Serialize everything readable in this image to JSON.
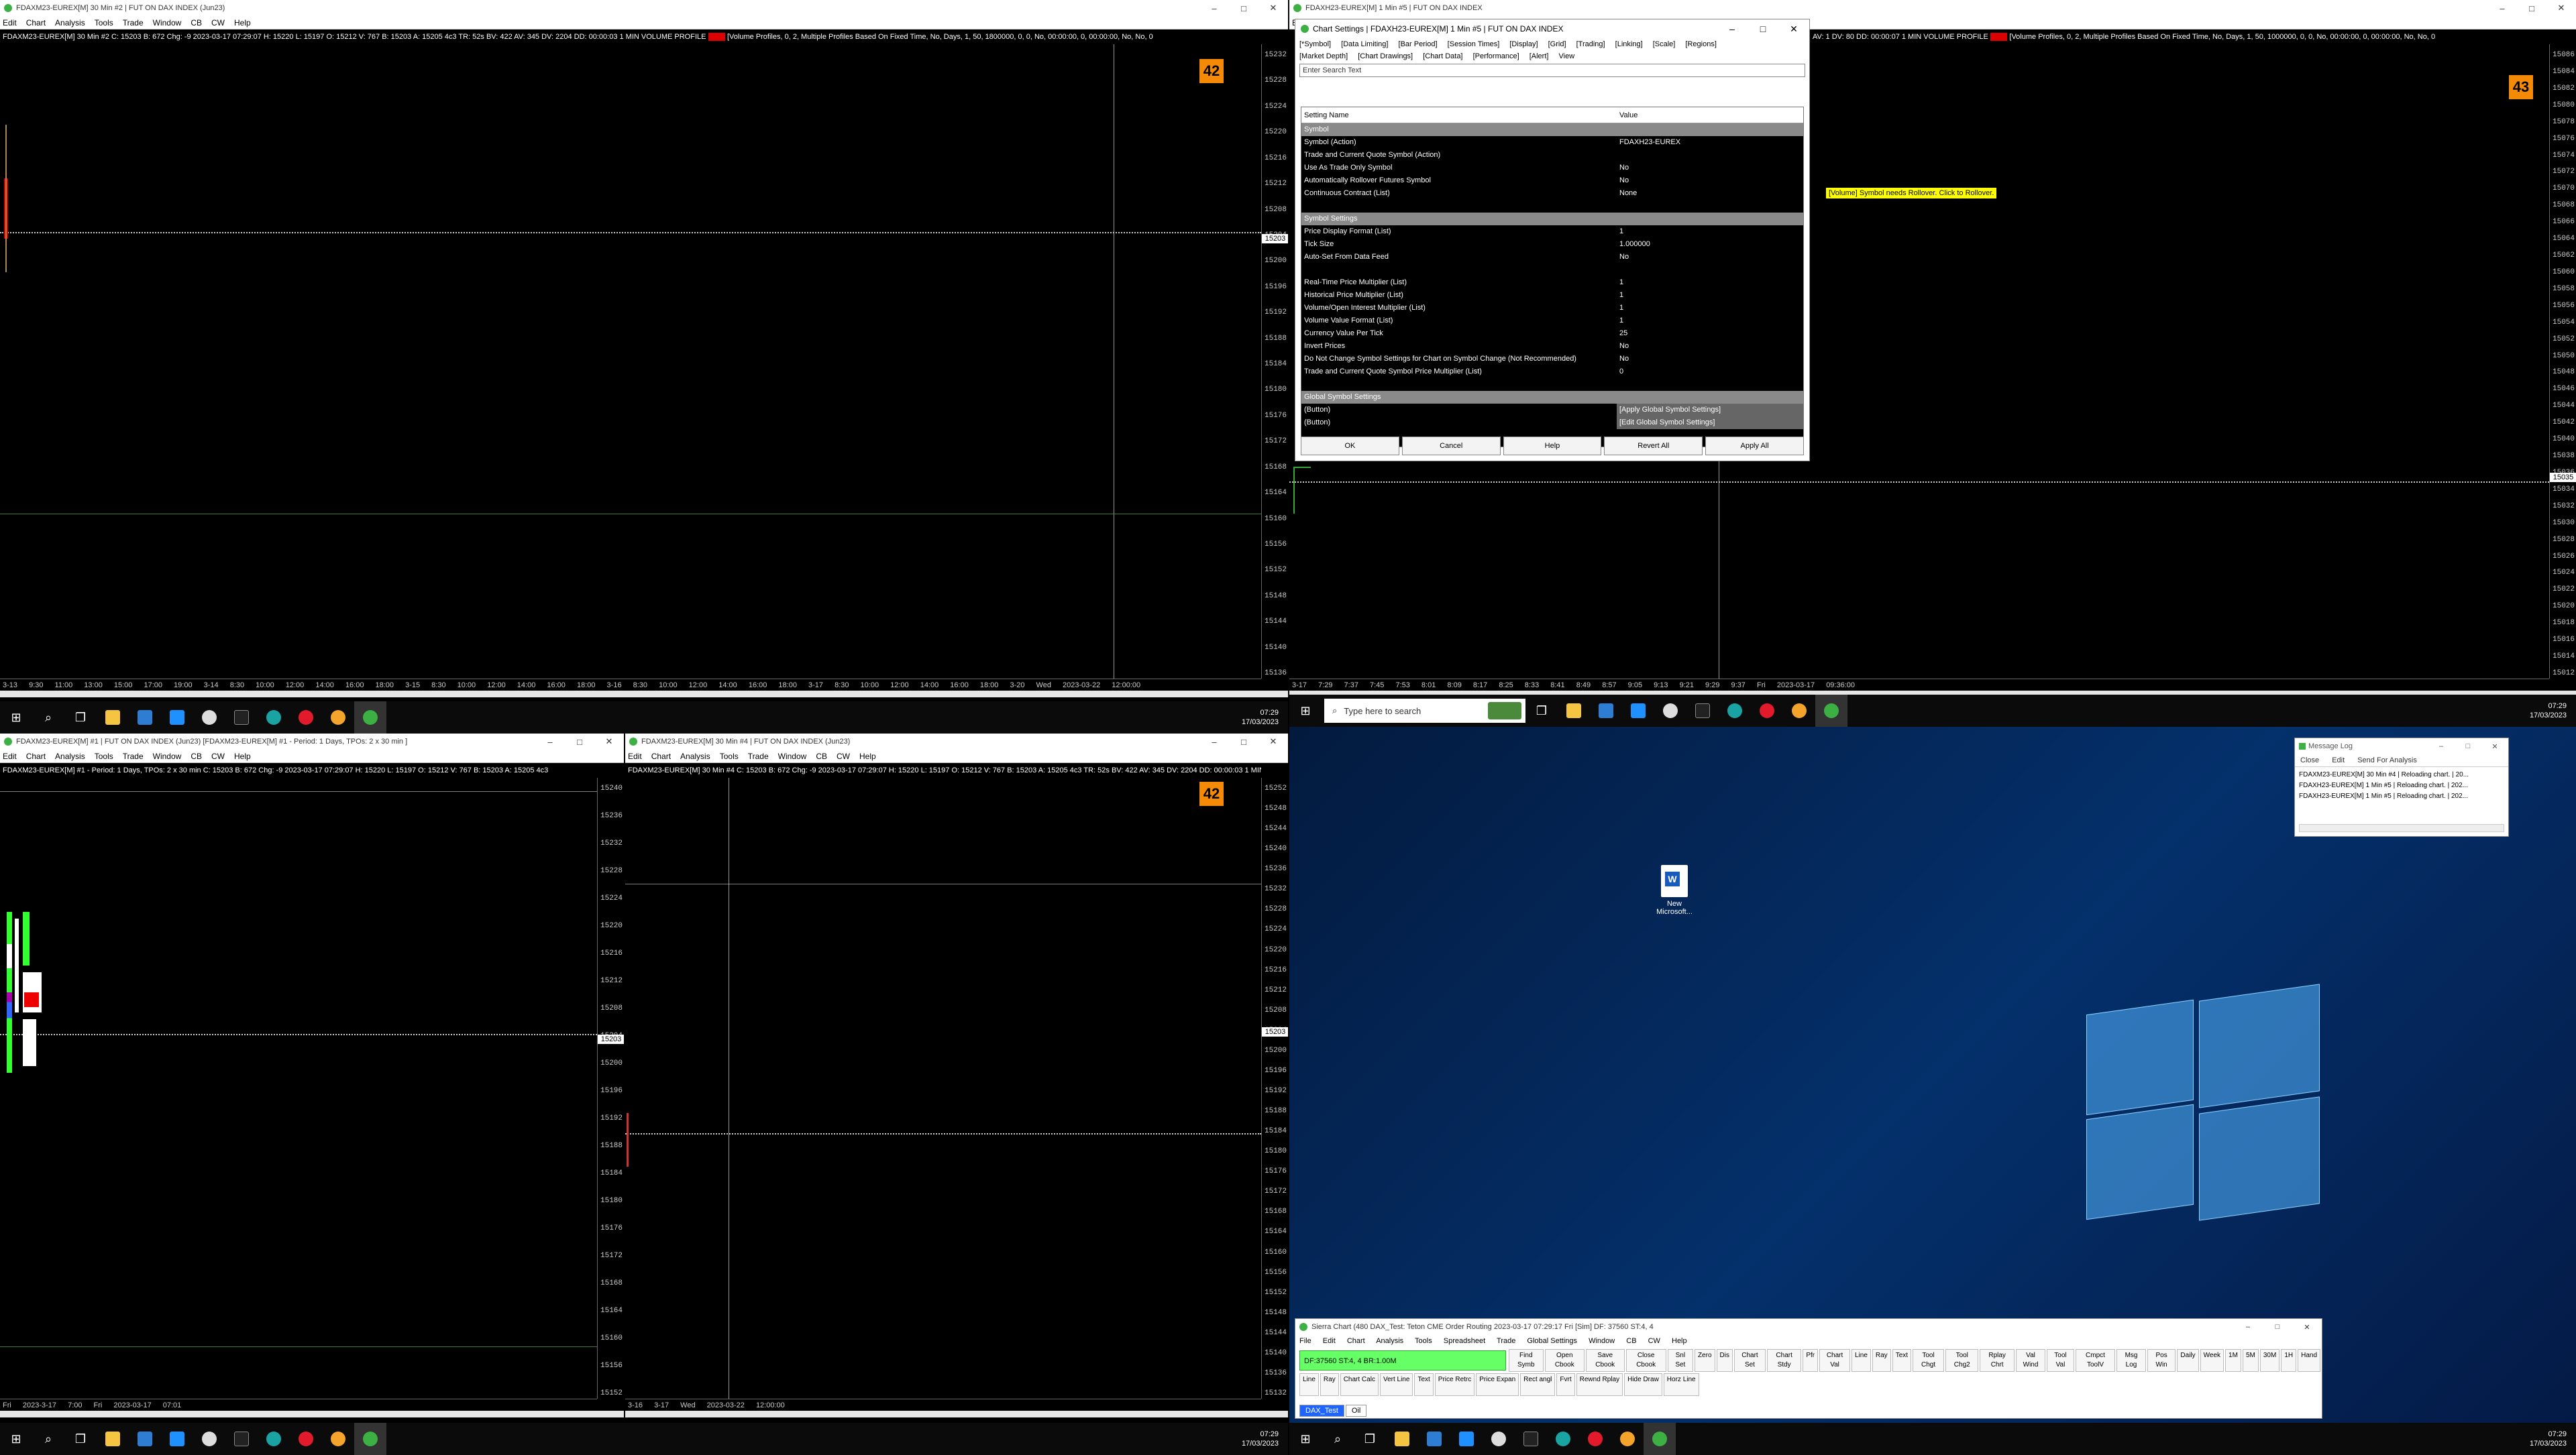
{
  "menus": {
    "chart_main": [
      "Edit",
      "Chart",
      "Analysis",
      "Tools",
      "Trade",
      "Window",
      "CB",
      "CW",
      "Help"
    ],
    "trade_main": [
      "File",
      "Edit",
      "Chart",
      "Analysis",
      "Tools",
      "Spreadsheet",
      "Trade",
      "Global Settings",
      "Window",
      "CB",
      "CW",
      "Help"
    ],
    "msglog": [
      "Close",
      "Edit",
      "Send For Analysis"
    ]
  },
  "charts": {
    "c1": {
      "title": "FDAXM23-EUREX[M]  30 Min  #2 | FUT ON DAX INDEX (Jun23)",
      "info": "FDAXM23-EUREX[M]  30 Min  #2  C: 15203  B: 672  Chg: -9  2023-03-17 07:29:07  H: 15220  L: 15197  O: 15212  V: 767  B: 15203  A: 15205  4c3  TR: 52s  BV: 422  AV: 345  DV: 2204  DD: 00:00:03  1 MIN VOLUME PROFILE",
      "info_tail": "[Volume Profiles, 0, 2, Multiple Profiles Based On Fixed Time, No, Days, 1, 50, 1800000, 0, 0, No, 00:00:00, 0, 00:00:00, No, No, 0",
      "badge": "42",
      "ticks": [
        "15232",
        "15228",
        "15224",
        "15220",
        "15216",
        "15212",
        "15208",
        "15204",
        "15200",
        "15196",
        "15192",
        "15188",
        "15184",
        "15180",
        "15176",
        "15172",
        "15168",
        "15164",
        "15160",
        "15156",
        "15152",
        "15148",
        "15144",
        "15140",
        "15136"
      ],
      "current": "15203",
      "time": "3-13  9:30  11:00  13:00  15:00  17:00  19:00  3-14  8:30  10:00  12:00  14:00  16:00  18:00  3-15  8:30  10:00  12:00  14:00  16:00  18:00  3-16  8:30  10:00  12:00  14:00  16:00  18:00  3-17  8:30  10:00  12:00  14:00  16:00  18:00  3-20  Wed 2023-03-22  12:00:00"
    },
    "c2": {
      "title": "FDAXH23-EUREX[M]  1 Min  #5 | FUT ON DAX INDEX",
      "info": "AV: 1  DV: 80  DD: 00:00:07  1 MIN VOLUME PROFILE",
      "info_tail": "[Volume Profiles, 0, 2, Multiple Profiles Based On Fixed Time, No, Days, 1, 50, 1000000, 0, 0, No, 00:00:00, 0, 00:00:00, No, No, 0",
      "badge": "43",
      "ticks": [
        "15086",
        "15084",
        "15082",
        "15080",
        "15078",
        "15076",
        "15074",
        "15072",
        "15070",
        "15068",
        "15066",
        "15064",
        "15062",
        "15060",
        "15058",
        "15056",
        "15054",
        "15052",
        "15050",
        "15048",
        "15046",
        "15044",
        "15042",
        "15040",
        "15038",
        "15036",
        "15034",
        "15032",
        "15030",
        "15028",
        "15026",
        "15024",
        "15022",
        "15020",
        "15018",
        "15016",
        "15014",
        "15012"
      ],
      "current": "15035",
      "time": "3-17  7:29  7:37  7:45  7:53  8:01  8:09  8:17  8:25  8:33  8:41  8:49  8:57  9:05  9:13  9:21  9:29  9:37  Fri 2023-03-17  09:36:00",
      "notice": "[Volume] Symbol needs Rollover. Click to Rollover."
    },
    "c3": {
      "title": "FDAXM23-EUREX[M]  #1 | FUT ON DAX INDEX (Jun23) [FDAXM23-EUREX[M]  #1 - Period: 1 Days, TPOs: 2 x 30 min ]",
      "info": "FDAXM23-EUREX[M]  #1 - Period: 1 Days, TPOs: 2 x 30 min  C: 15203  B: 672  Chg: -9  2023-03-17 07:29:07  H: 15220  L: 15197  O: 15212  V: 767  B: 15203  A: 15205  4c3",
      "ticks": [
        "15240",
        "15236",
        "15232",
        "15228",
        "15224",
        "15220",
        "15216",
        "15212",
        "15208",
        "15204",
        "15200",
        "15196",
        "15192",
        "15188",
        "15184",
        "15180",
        "15176",
        "15172",
        "15168",
        "15164",
        "15160",
        "15156",
        "15152"
      ],
      "current": "15203",
      "time": "Fri 2023-3-17  7:00   Fri 2023-03-17  07:01"
    },
    "c4": {
      "title": "FDAXM23-EUREX[M]  30 Min  #4 | FUT ON DAX INDEX (Jun23)",
      "info": "FDAXM23-EUREX[M]  30 Min  #4  C: 15203  B: 672  Chg: -9  2023-03-17 07:29:07  H: 15220  L: 15197  O: 15212  V: 767  B: 15203  A: 15205  4c3  TR: 52s  BV: 422  AV: 345  DV: 2204  DD: 00:00:03  1 MIN VOLUME PROFILE",
      "badge": "42",
      "ticks": [
        "15252",
        "15248",
        "15244",
        "15240",
        "15236",
        "15232",
        "15228",
        "15224",
        "15220",
        "15216",
        "15212",
        "15208",
        "15204",
        "15200",
        "15196",
        "15192",
        "15188",
        "15184",
        "15180",
        "15176",
        "15172",
        "15168",
        "15164",
        "15160",
        "15156",
        "15152",
        "15148",
        "15144",
        "15140",
        "15136",
        "15132"
      ],
      "current": "15203",
      "time": "3-16  3-17  Wed 2023-03-22  12:00:00"
    }
  },
  "dialog": {
    "title": "Chart Settings | FDAXH23-EUREX[M]  1 Min  #5 | FUT ON DAX INDEX",
    "tabs1": [
      "[*Symbol]",
      "[Data Limiting]",
      "[Bar Period]",
      "[Session Times]",
      "[Display]",
      "[Grid]",
      "[Trading]",
      "[Linking]",
      "[Scale]",
      "[Regions]"
    ],
    "tabs2": [
      "[Market Depth]",
      "[Chart Drawings]",
      "[Chart Data]",
      "[Performance]",
      "[Alert]",
      "View"
    ],
    "search_placeholder": "Enter Search Text",
    "col_name": "Setting Name",
    "col_value": "Value",
    "rows": [
      {
        "n": "Symbol",
        "v": "",
        "t": "sect"
      },
      {
        "n": "Symbol (Action)",
        "v": "FDAXH23-EUREX",
        "t": ""
      },
      {
        "n": "Trade and Current Quote Symbol (Action)",
        "v": "",
        "t": ""
      },
      {
        "n": "Use As Trade Only Symbol",
        "v": "No",
        "t": ""
      },
      {
        "n": "Automatically Rollover Futures Symbol",
        "v": "No",
        "t": ""
      },
      {
        "n": "Continuous Contract (List)",
        "v": "None",
        "t": ""
      },
      {
        "n": "",
        "v": "",
        "t": ""
      },
      {
        "n": "Symbol Settings",
        "v": "",
        "t": "sect"
      },
      {
        "n": "Price Display Format (List)",
        "v": "1",
        "t": ""
      },
      {
        "n": "Tick Size",
        "v": "1.000000",
        "t": ""
      },
      {
        "n": "Auto-Set From Data Feed",
        "v": "No",
        "t": ""
      },
      {
        "n": "",
        "v": "",
        "t": ""
      },
      {
        "n": "Real-Time Price Multiplier (List)",
        "v": "1",
        "t": ""
      },
      {
        "n": "Historical Price Multiplier (List)",
        "v": "1",
        "t": ""
      },
      {
        "n": "Volume/Open Interest Multiplier (List)",
        "v": "1",
        "t": ""
      },
      {
        "n": "Volume Value Format (List)",
        "v": "1",
        "t": ""
      },
      {
        "n": "Currency Value Per Tick",
        "v": "25",
        "t": ""
      },
      {
        "n": "Invert Prices",
        "v": "No",
        "t": ""
      },
      {
        "n": "Do Not Change Symbol Settings for Chart on Symbol Change (Not Recommended)",
        "v": "No",
        "t": ""
      },
      {
        "n": "Trade and Current Quote Symbol Price Multiplier (List)",
        "v": "0",
        "t": ""
      },
      {
        "n": "",
        "v": "",
        "t": ""
      },
      {
        "n": "Global Symbol Settings",
        "v": "",
        "t": "sect"
      },
      {
        "n": "(Button)",
        "v": "[Apply Global Symbol Settings]",
        "t": "btn"
      },
      {
        "n": "(Button)",
        "v": "[Edit Global Symbol Settings]",
        "t": "btn"
      }
    ],
    "buttons": [
      "OK",
      "Cancel",
      "Help",
      "Revert All",
      "Apply All"
    ]
  },
  "msglog": {
    "title": "Message Log",
    "lines": [
      "FDAXM23-EUREX[M]  30 Min  #4 | Reloading chart. | 20...",
      "FDAXH23-EUREX[M]  1 Min  #5 | Reloading chart. | 202...",
      "FDAXH23-EUREX[M]  1 Min  #5 | Reloading chart. | 202..."
    ]
  },
  "desktop": {
    "icon_label": "New Microsoft...",
    "search_placeholder": "Type here to search"
  },
  "trade": {
    "title": "Sierra Chart (480 DAX_Test: Teton CME Order Routing 2023-03-17  07:29:17 Fri [Sim]  DF: 37560  ST:4, 4",
    "status": "DF:37560  ST:4, 4  BR:1.00M",
    "tools": [
      "Find Symb",
      "Open Cbook",
      "Save Cbook",
      "Close Cbook",
      "Snl Set",
      "Zero",
      "Dis",
      "Chart Set",
      "Chart Stdy",
      "Pfr",
      "Chart Val",
      "Line",
      "Ray",
      "Text",
      "Tool Chgt",
      "Tool Chg2",
      "Rplay Chrt",
      "Val Wind",
      "Tool Val",
      "Cmpct ToolV",
      "Msg Log",
      "Pos Win",
      "Daily",
      "Week",
      "1M",
      "5M",
      "30M",
      "1H",
      "Hand"
    ],
    "tools2": [
      "Line",
      "Ray",
      "Chart Calc",
      "Vert Line",
      "Text",
      "Price Retrc",
      "Price Expan",
      "Rect angl",
      "Fvrt",
      "Rewnd Rplay",
      "Hide Draw",
      "Horz Line"
    ],
    "tabs": [
      "DAX_Test",
      "Oil"
    ]
  },
  "clock": {
    "time": "07:29",
    "date": "17/03/2023"
  }
}
